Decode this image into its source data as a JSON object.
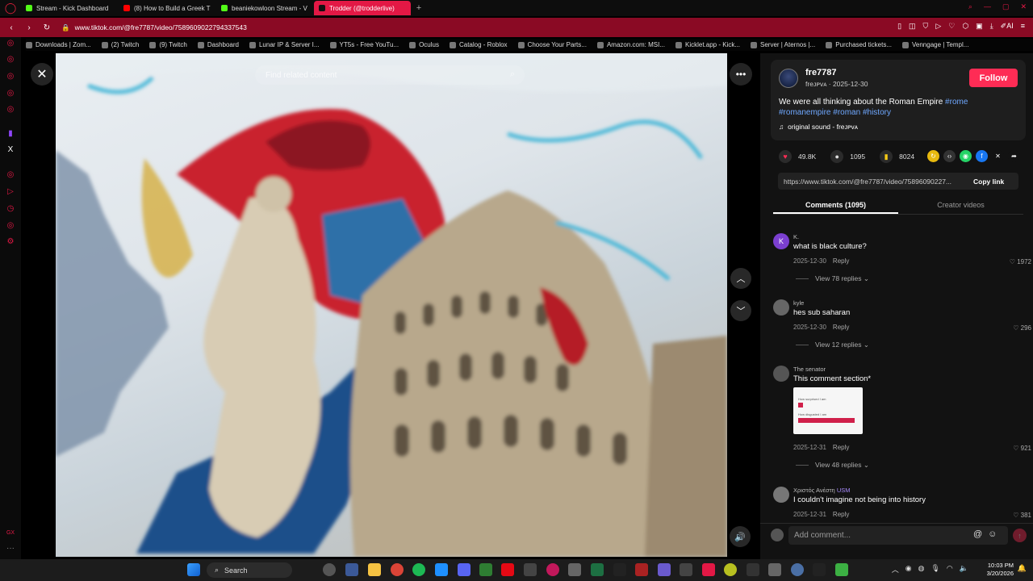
{
  "browser": {
    "tabs": [
      {
        "label": "Stream - Kick Dashboard",
        "color": "#53fc18"
      },
      {
        "label": "(8) How to Build a Greek T",
        "color": "#ff0000"
      },
      {
        "label": "beaniekowloon Stream - V",
        "color": "#53fc18"
      },
      {
        "label": "Trodder (@trodderlive)",
        "color": "#ffffff",
        "active": true
      }
    ],
    "url": "www.tiktok.com/@fre7787/video/7589609022794337543",
    "bookmarks": [
      "Downloads | Zom...",
      "(2) Twitch",
      "(9) Twitch",
      "Dashboard",
      "Lunar IP & Server I...",
      "YT5s - Free YouTu...",
      "Oculus",
      "Catalog - Roblox",
      "Choose Your Parts...",
      "Amazon.com: MSI...",
      "Kicklet.app - Kick...",
      "Server | Aternos |...",
      "Purchased tickets...",
      "Venngage | Templ..."
    ],
    "extension_ai_label": "AI"
  },
  "video": {
    "search_placeholder": "Find related content"
  },
  "post": {
    "author": "fre7787",
    "author_sub": "freᴊᴘᴠᴀ · 2025-12-30",
    "follow_label": "Follow",
    "description": "We were all thinking about the Roman Empire",
    "hashtags": [
      "#rome",
      "#romanempire",
      "#roman",
      "#history"
    ],
    "sound": "original sound - freᴊᴘᴠᴀ",
    "likes": "49.8K",
    "comments_count": "1095",
    "saves": "8024",
    "link": "https://www.tiktok.com/@fre7787/video/75896090227...",
    "copy_link_label": "Copy link",
    "tab_comments": "Comments (1095)",
    "tab_creator": "Creator videos"
  },
  "comments": [
    {
      "user": "K.",
      "avatar_letter": "K",
      "avatar_color": "#7b3fd0",
      "text": "what is black culture?",
      "date": "2025-12-30",
      "reply": "Reply",
      "likes": "1972",
      "replies": "View 78 replies"
    },
    {
      "user": "kyle",
      "avatar_letter": "",
      "avatar_color": "#666666",
      "text": "hes sub saharan",
      "date": "2025-12-30",
      "reply": "Reply",
      "likes": "296",
      "replies": "View 12 replies"
    },
    {
      "user": "The senator",
      "avatar_letter": "",
      "avatar_color": "#555555",
      "text": "This comment section*",
      "date": "2025-12-31",
      "reply": "Reply",
      "likes": "921",
      "replies": "View 48 replies",
      "thumb_lines": [
        "How surprised I am",
        "How disgusted I am"
      ]
    },
    {
      "user": "Χριστός Ανέστη",
      "badge": "USM",
      "avatar_letter": "",
      "avatar_color": "#777777",
      "text": "I couldn't imagine not being into history",
      "date": "2025-12-31",
      "reply": "Reply",
      "likes": "381"
    }
  ],
  "add_comment": {
    "placeholder": "Add comment..."
  },
  "taskbar": {
    "search_label": "Search",
    "time": "10:03 PM",
    "date": "3/20/2026"
  }
}
